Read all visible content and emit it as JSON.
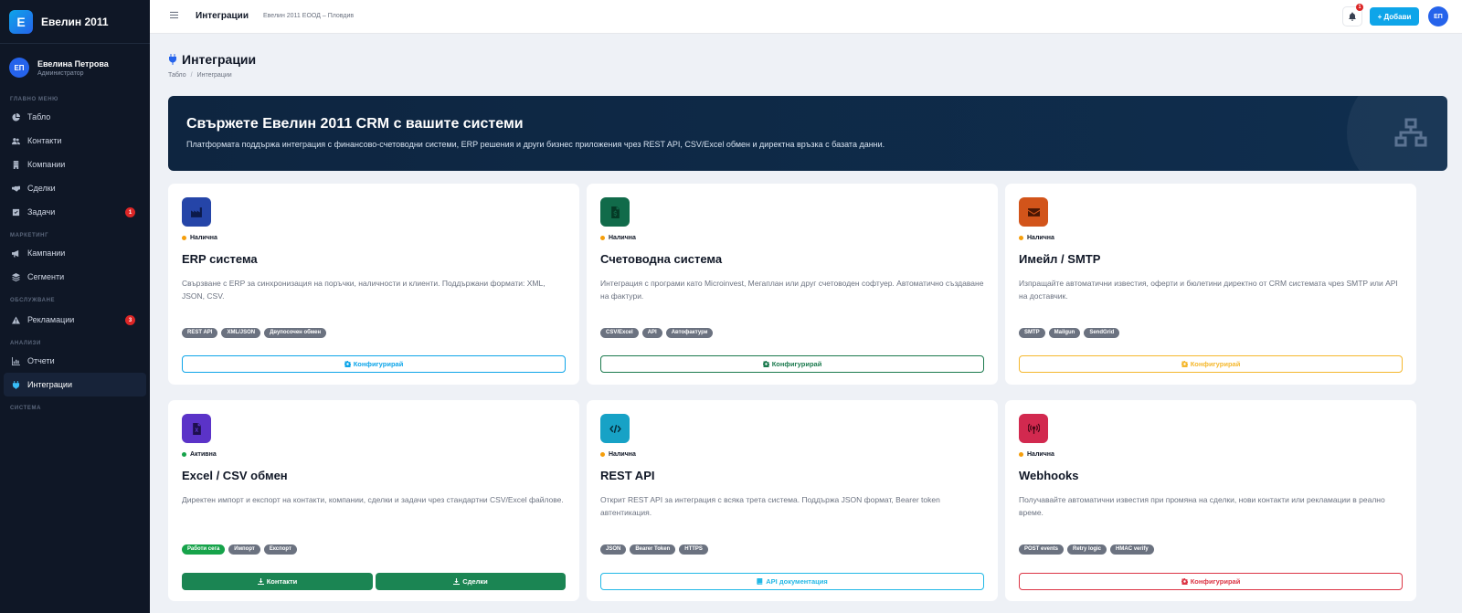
{
  "sidebar": {
    "brand_letter": "Е",
    "brand_name": "Евелин 2011",
    "user": {
      "initials": "ЕП",
      "name": "Евелина Петрова",
      "role": "Администратор"
    },
    "sections": {
      "main": "ГЛАВНО МЕНЮ",
      "marketing": "МАРКЕТИНГ",
      "service": "ОБСЛУЖВАНЕ",
      "analytics": "АНАЛИЗИ",
      "system": "СИСТЕМА"
    },
    "items": {
      "dashboard": {
        "label": "Табло",
        "icon": "pie-chart-icon"
      },
      "contacts": {
        "label": "Контакти",
        "icon": "users-icon"
      },
      "companies": {
        "label": "Компании",
        "icon": "building-icon"
      },
      "deals": {
        "label": "Сделки",
        "icon": "handshake-icon"
      },
      "tasks": {
        "label": "Задачи",
        "icon": "checkbox-icon",
        "badge": "1"
      },
      "campaigns": {
        "label": "Кампании",
        "icon": "megaphone-icon"
      },
      "segments": {
        "label": "Сегменти",
        "icon": "layers-icon"
      },
      "complaints": {
        "label": "Рекламации",
        "icon": "warning-icon",
        "badge": "3"
      },
      "reports": {
        "label": "Отчети",
        "icon": "bar-chart-icon"
      },
      "integrations": {
        "label": "Интеграции",
        "icon": "plug-icon",
        "active": true
      }
    }
  },
  "topbar": {
    "title": "Интеграции",
    "subtitle": "Евелин 2011 ЕООД – Пловдив",
    "bell_badge": "1",
    "add_label": "+ Добави",
    "avatar_initials": "ЕП"
  },
  "page": {
    "title": "Интеграции",
    "breadcrumb": {
      "home": "Табло",
      "sep": "/",
      "current": "Интеграции"
    }
  },
  "hero": {
    "title": "Свържете Евелин 2011 CRM с вашите системи",
    "text": "Платформата поддържа интеграция с финансово-счетоводни системи, ERP решения и други бизнес приложения чрез REST API, CSV/Excel обмен и директна връзка с базата данни.",
    "icon": "network-icon"
  },
  "cards": [
    {
      "title": "ERP система",
      "status": "Налична",
      "status_color": "#f59e0b",
      "icon": "factory-icon",
      "icon_color": "#2545a8",
      "desc": "Свързване с ERP за синхронизация на поръчки, наличности и клиенти. Поддържани формати: XML, JSON, CSV.",
      "tags": [
        "REST API",
        "XML/JSON",
        "Двупосочен обмен"
      ],
      "button": "Конфигурирай",
      "button_color": "#0ea5e9"
    },
    {
      "title": "Счетоводна система",
      "status": "Налична",
      "status_color": "#f59e0b",
      "icon": "invoice-icon",
      "icon_color": "#116b4a",
      "desc": "Интеграция с програми като Microinvest, Мегаплан или друг счетоводен софтуер. Автоматично създаване на фактури.",
      "tags": [
        "CSV/Excel",
        "API",
        "Автофактури"
      ],
      "button": "Конфигурирай",
      "button_color": "#1b7a4e"
    },
    {
      "title": "Имейл / SMTP",
      "status": "Налична",
      "status_color": "#f59e0b",
      "icon": "envelope-icon",
      "icon_color": "#d2541a",
      "desc": "Изпращайте автоматични известия, оферти и бюлетини директно от CRM системата чрез SMTP или API на доставчик.",
      "tags": [
        "SMTP",
        "Mailgun",
        "SendGrid"
      ],
      "button": "Конфигурирай",
      "button_color": "#f5b82e"
    },
    {
      "title": "Excel / CSV обмен",
      "status": "Активна",
      "status_color": "#16a34a",
      "icon": "excel-file-icon",
      "icon_color": "#5b33c8",
      "desc": "Директен импорт и експорт на контакти, компании, сделки и задачи чрез стандартни CSV/Excel файлове.",
      "tags": [
        "Работи сега",
        "Импорт",
        "Експорт"
      ],
      "buttons": [
        "Контакти",
        "Сделки"
      ]
    },
    {
      "title": "REST API",
      "status": "Налична",
      "status_color": "#f59e0b",
      "icon": "code-icon",
      "icon_color": "#17a2c6",
      "desc": "Открит REST API за интеграция с всяка трета система. Поддържа JSON формат, Bearer token автентикация.",
      "tags": [
        "JSON",
        "Bearer Token",
        "HTTPS"
      ],
      "button": "API документация",
      "button_color": "#22b8e6"
    },
    {
      "title": "Webhooks",
      "status": "Налична",
      "status_color": "#f59e0b",
      "icon": "broadcast-icon",
      "icon_color": "#d2294f",
      "desc": "Получавайте автоматични известия при промяна на сделки, нови контакти или рекламации в реално време.",
      "tags": [
        "POST events",
        "Retry logic",
        "HMAC verify"
      ],
      "button": "Конфигурирай",
      "button_color": "#dc3545"
    }
  ]
}
